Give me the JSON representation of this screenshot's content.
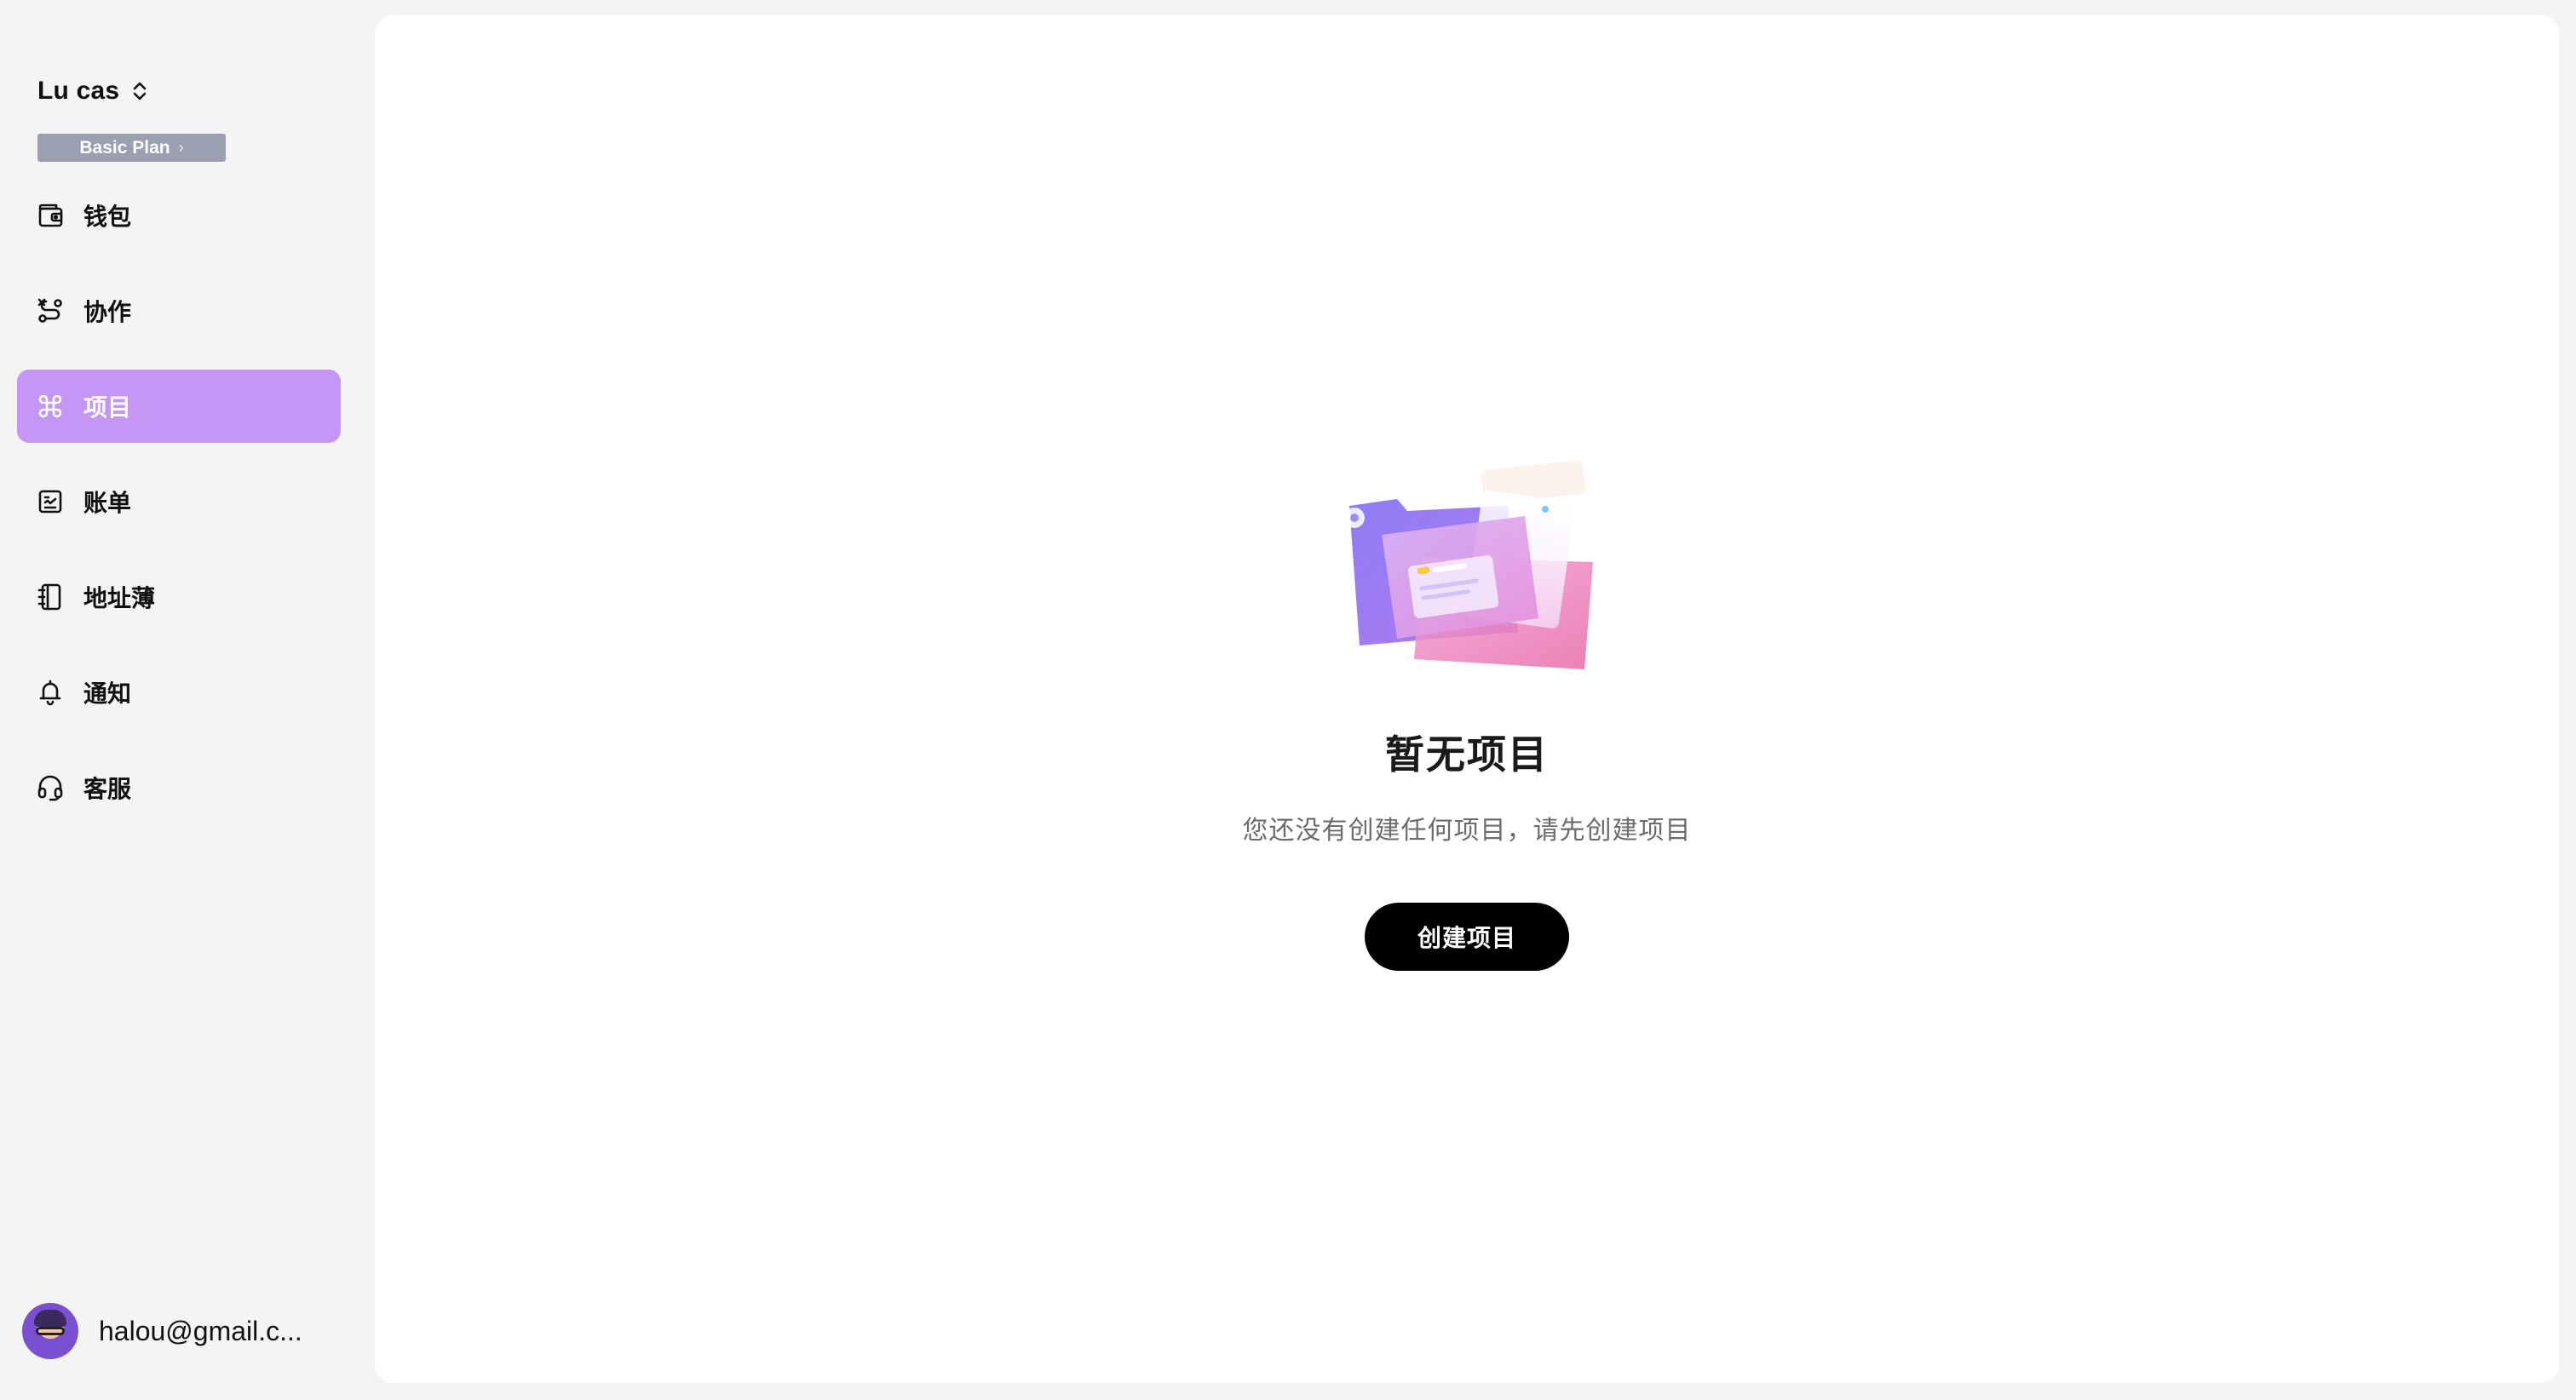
{
  "account": {
    "name": "Lu cas",
    "switch_icon": "chevron-up-down-icon",
    "plan": {
      "label": "Basic Plan",
      "chevron": "›"
    }
  },
  "sidebar": {
    "items": [
      {
        "label": "钱包",
        "icon": "wallet-icon",
        "active": false
      },
      {
        "label": "协作",
        "icon": "route-icon",
        "active": false
      },
      {
        "label": "项目",
        "icon": "command-icon",
        "active": true
      },
      {
        "label": "账单",
        "icon": "receipt-icon",
        "active": false
      },
      {
        "label": "地址薄",
        "icon": "address-book-icon",
        "active": false
      },
      {
        "label": "通知",
        "icon": "bell-icon",
        "active": false
      },
      {
        "label": "客服",
        "icon": "headset-icon",
        "active": false
      }
    ]
  },
  "user": {
    "email": "halou@gmail.c..."
  },
  "main": {
    "empty_state": {
      "illustration": "folder-illustration",
      "title": "暂无项目",
      "description": "您还没有创建任何项目，请先创建项目",
      "button_label": "创建项目"
    }
  },
  "colors": {
    "active_nav_bg": "#c596f3",
    "plan_badge_bg": "#9aa0b0",
    "page_bg": "#f4f4f5",
    "panel_bg": "#ffffff",
    "primary_button_bg": "#000000"
  }
}
